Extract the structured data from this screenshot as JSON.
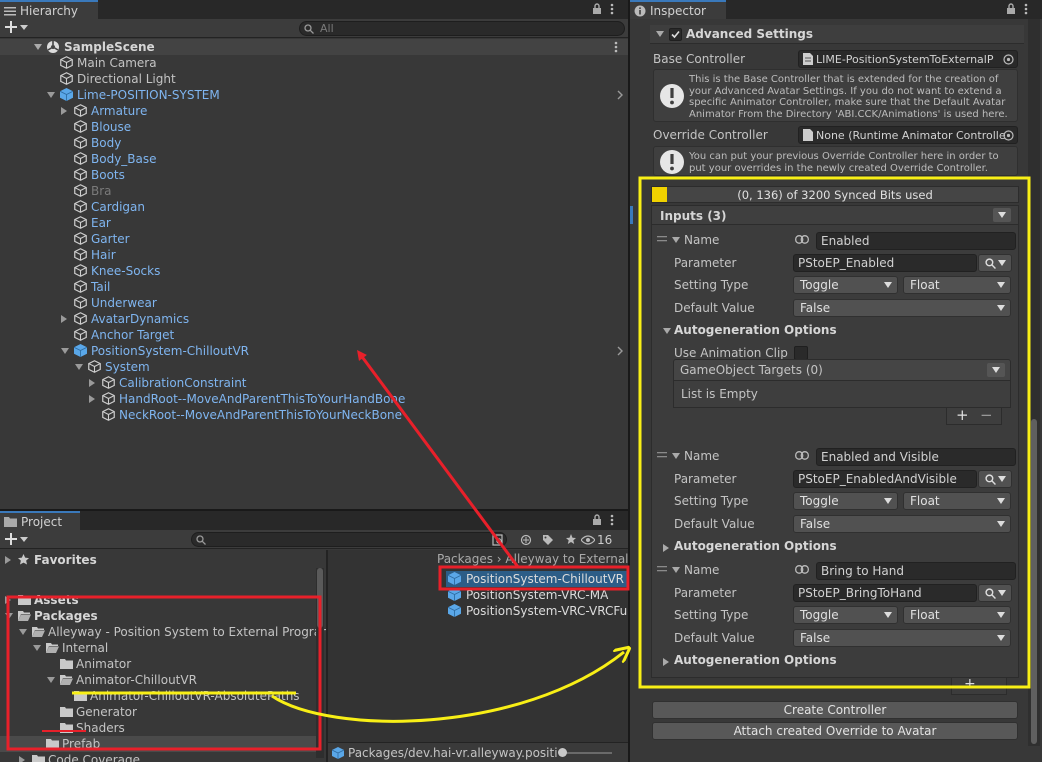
{
  "hierarchy": {
    "tab_label": "Hierarchy",
    "search_placeholder": "All",
    "scene_name": "SampleScene",
    "items": [
      {
        "label": "Main Camera",
        "indent": 0,
        "icon": "cube-outline",
        "color": "normal",
        "arrow": "none"
      },
      {
        "label": "Directional Light",
        "indent": 0,
        "icon": "cube-outline",
        "color": "normal",
        "arrow": "none"
      },
      {
        "label": "Lime-POSITION-SYSTEM",
        "indent": 0,
        "icon": "prefab-cube",
        "color": "blue",
        "arrow": "down",
        "chevron": true
      },
      {
        "label": "Armature",
        "indent": 1,
        "icon": "cube-outline",
        "color": "blue",
        "arrow": "right"
      },
      {
        "label": "Blouse",
        "indent": 1,
        "icon": "cube-outline",
        "color": "blue",
        "arrow": "none"
      },
      {
        "label": "Body",
        "indent": 1,
        "icon": "cube-outline",
        "color": "blue",
        "arrow": "none"
      },
      {
        "label": "Body_Base",
        "indent": 1,
        "icon": "cube-outline",
        "color": "blue",
        "arrow": "none"
      },
      {
        "label": "Boots",
        "indent": 1,
        "icon": "cube-outline",
        "color": "blue",
        "arrow": "none"
      },
      {
        "label": "Bra",
        "indent": 1,
        "icon": "cube-outline",
        "color": "dim",
        "arrow": "none"
      },
      {
        "label": "Cardigan",
        "indent": 1,
        "icon": "cube-outline",
        "color": "blue",
        "arrow": "none"
      },
      {
        "label": "Ear",
        "indent": 1,
        "icon": "cube-outline",
        "color": "blue",
        "arrow": "none"
      },
      {
        "label": "Garter",
        "indent": 1,
        "icon": "cube-outline",
        "color": "blue",
        "arrow": "none"
      },
      {
        "label": "Hair",
        "indent": 1,
        "icon": "cube-outline",
        "color": "blue",
        "arrow": "none"
      },
      {
        "label": "Knee-Socks",
        "indent": 1,
        "icon": "cube-outline",
        "color": "blue",
        "arrow": "none"
      },
      {
        "label": "Tail",
        "indent": 1,
        "icon": "cube-outline",
        "color": "blue",
        "arrow": "none"
      },
      {
        "label": "Underwear",
        "indent": 1,
        "icon": "cube-outline",
        "color": "blue",
        "arrow": "none"
      },
      {
        "label": "AvatarDynamics",
        "indent": 1,
        "icon": "cube-outline",
        "color": "blue",
        "arrow": "right"
      },
      {
        "label": "Anchor Target",
        "indent": 1,
        "icon": "cube-outline",
        "color": "blue",
        "arrow": "none"
      },
      {
        "label": "PositionSystem-ChilloutVR",
        "indent": 1,
        "icon": "prefab-cube",
        "color": "blue",
        "arrow": "down",
        "chevron": true
      },
      {
        "label": "System",
        "indent": 2,
        "icon": "cube-outline",
        "color": "blue",
        "arrow": "down"
      },
      {
        "label": "CalibrationConstraint",
        "indent": 3,
        "icon": "cube-outline",
        "color": "blue",
        "arrow": "right"
      },
      {
        "label": "HandRoot--MoveAndParentThisToYourHandBone",
        "indent": 3,
        "icon": "cube-outline",
        "color": "blue",
        "arrow": "right"
      },
      {
        "label": "NeckRoot--MoveAndParentThisToYourNeckBone",
        "indent": 3,
        "icon": "cube-outline",
        "color": "blue",
        "arrow": "none"
      }
    ]
  },
  "project": {
    "tab_label": "Project",
    "count_badge": "16",
    "tree": [
      {
        "label": "Favorites",
        "indent": 0,
        "bold": true,
        "arrow": "right",
        "icon": "star-icon"
      },
      {
        "label": "Assets",
        "indent": 0,
        "bold": true,
        "arrow": "right",
        "icon": "folder-icon"
      },
      {
        "label": "Packages",
        "indent": 0,
        "bold": true,
        "arrow": "down",
        "icon": "folder-open-icon"
      },
      {
        "label": "Alleyway - Position System to External Program",
        "indent": 1,
        "arrow": "down",
        "icon": "folder-open-icon"
      },
      {
        "label": "Internal",
        "indent": 2,
        "arrow": "down",
        "icon": "folder-open-icon"
      },
      {
        "label": "Animator",
        "indent": 3,
        "arrow": "none",
        "icon": "folder-icon"
      },
      {
        "label": "Animator-ChilloutVR",
        "indent": 3,
        "arrow": "down",
        "icon": "folder-open-icon"
      },
      {
        "label": "Animator-ChilloutVR-AbsolutePaths",
        "indent": 4,
        "arrow": "none",
        "icon": "folder-icon"
      },
      {
        "label": "Generator",
        "indent": 3,
        "arrow": "none",
        "icon": "folder-icon"
      },
      {
        "label": "Shaders",
        "indent": 3,
        "arrow": "none",
        "icon": "folder-icon"
      },
      {
        "label": "Prefab",
        "indent": 2,
        "arrow": "none",
        "icon": "folder-icon",
        "selected": true
      },
      {
        "label": "Code Coverage",
        "indent": 1,
        "arrow": "right",
        "icon": "folder-icon"
      }
    ],
    "breadcrumb": "Packages › Alleyway to External P",
    "assets": [
      {
        "label": "PositionSystem-ChilloutVR",
        "selected": true
      },
      {
        "label": "PositionSystem-VRC-MA",
        "selected": false
      },
      {
        "label": "PositionSystem-VRC-VRCFu",
        "selected": false
      }
    ],
    "status_path": "Packages/dev.hai-vr.alleyway.positio"
  },
  "inspector": {
    "tab_label": "Inspector",
    "advanced_settings_label": "Advanced Settings",
    "base_controller_label": "Base Controller",
    "base_controller_value": "LIME-PositionSystemToExternalP",
    "base_help": "This is the Base Controller that is extended for the creation of your Advanced Avatar Settings. If you do not want to extend a specific Animator Controller, make sure that the Default Avatar Animator From the Directory 'ABI.CCK/Animations' is used here.",
    "override_controller_label": "Override Controller",
    "override_controller_value": "None (Runtime Animator Controlle",
    "override_help": "You can put your previous Override Controller here in order to put your overrides in the newly created Override Controller.",
    "synced_bits": "(0, 136) of 3200 Synced Bits used",
    "inputs_header": "Inputs (3)",
    "labels": {
      "name": "Name",
      "parameter": "Parameter",
      "setting_type": "Setting Type",
      "default_value": "Default Value",
      "autogen": "Autogeneration Options",
      "use_anim_clip": "Use Animation Clip",
      "go_targets": "GameObject Targets (0)",
      "list_empty": "List is Empty",
      "plus": "+",
      "minus": "−"
    },
    "inputs": [
      {
        "name": "Enabled",
        "parameter": "PStoEP_Enabled",
        "type": "Toggle",
        "subtype": "Float",
        "default": "False",
        "expanded": true
      },
      {
        "name": "Enabled and Visible",
        "parameter": "PStoEP_EnabledAndVisible",
        "type": "Toggle",
        "subtype": "Float",
        "default": "False",
        "expanded": false
      },
      {
        "name": "Bring to Hand",
        "parameter": "PStoEP_BringToHand",
        "type": "Toggle",
        "subtype": "Float",
        "default": "False",
        "expanded": false
      }
    ],
    "create_controller_label": "Create Controller",
    "attach_override_label": "Attach created Override to Avatar"
  },
  "colors": {
    "accent_blue": "#7fb5f0",
    "annotation_red": "#e8202a",
    "annotation_yellow": "#f8ef16",
    "panel_bg": "#383838"
  }
}
